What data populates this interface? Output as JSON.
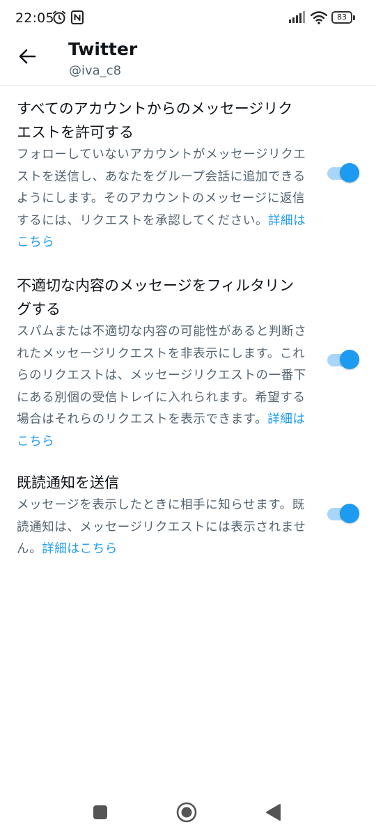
{
  "status_bar": {
    "time": "22:05",
    "battery": "83",
    "icons": [
      "alarm-icon",
      "nfc-icon",
      "signal-icon",
      "wifi-icon",
      "battery-icon"
    ]
  },
  "header": {
    "back_icon": "arrow-left-icon",
    "title": "Twitter",
    "subtitle": "@iva_c8"
  },
  "settings": [
    {
      "title": "すべてのアカウントからのメッセージリクエストを許可する",
      "description": "フォローしていないアカウントがメッセージリクエストを送信し、あなたをグループ会話に追加できるようにします。そのアカウントのメッセージに返信するには、リクエストを承認してください。",
      "link": "詳細はこちら",
      "enabled": true
    },
    {
      "title": "不適切な内容のメッセージをフィルタリングする",
      "description": "スパムまたは不適切な内容の可能性があると判断されたメッセージリクエストを非表示にします。これらのリクエストは、メッセージリクエストの一番下にある別個の受信トレイに入れられます。希望する場合はそれらのリクエストを表示できます。",
      "link": "詳細はこちら",
      "enabled": true
    },
    {
      "title": "既読通知を送信",
      "description": "メッセージを表示したときに相手に知らせます。既読通知は、メッセージリクエストには表示されません。",
      "link": "詳細はこちら",
      "enabled": true
    }
  ],
  "nav_bar": {
    "icons": [
      "recent-apps-icon",
      "home-icon",
      "back-triangle-icon"
    ]
  },
  "colors": {
    "accent": "#1d9bf0",
    "toggle_track": "#a9d6f8",
    "primary_text": "#0f1419",
    "secondary_text": "#536471"
  }
}
